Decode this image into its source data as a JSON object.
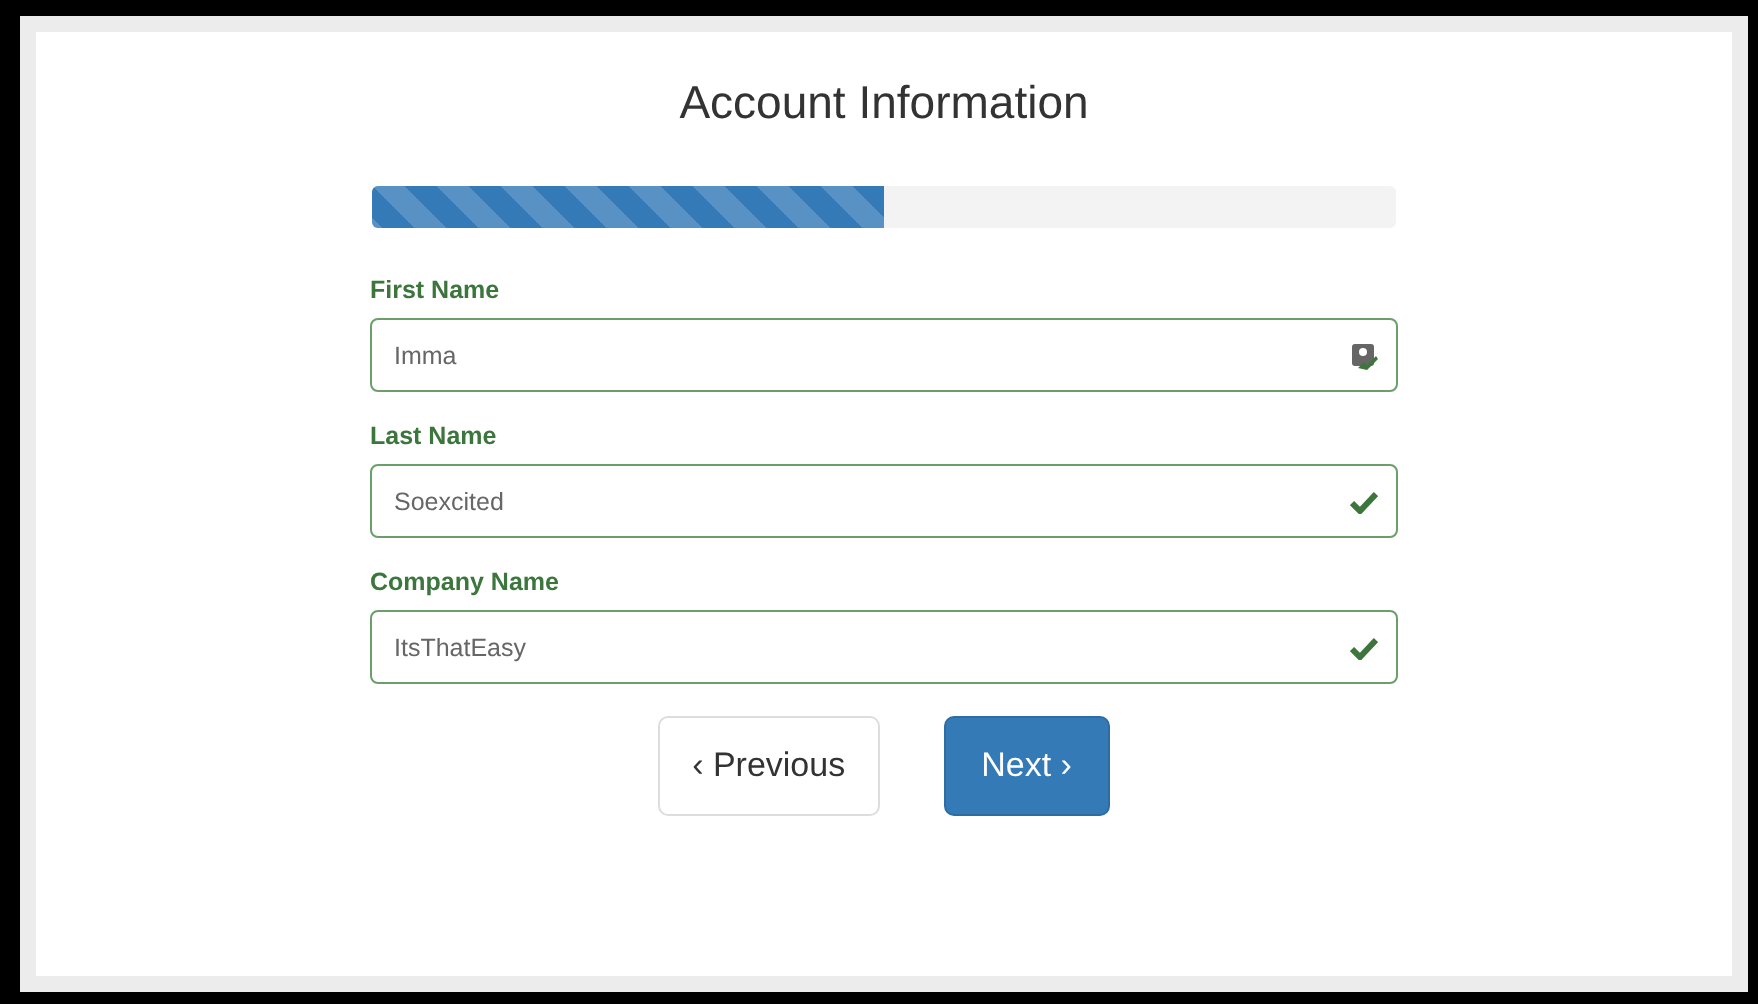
{
  "title": "Account Information",
  "progress": {
    "level": 0.5
  },
  "fields": [
    {
      "label": "First Name",
      "value": "Imma",
      "kind": "autofill",
      "valid": true
    },
    {
      "label": "Last Name",
      "value": "Soexcited",
      "kind": "check",
      "valid": true
    },
    {
      "label": "Company Name",
      "value": "ItsThatEasy",
      "kind": "check",
      "valid": true
    }
  ],
  "buttons": [
    {
      "label": "‹ Previous",
      "kind": "default"
    },
    {
      "label": "Next ›",
      "kind": "primary"
    }
  ]
}
